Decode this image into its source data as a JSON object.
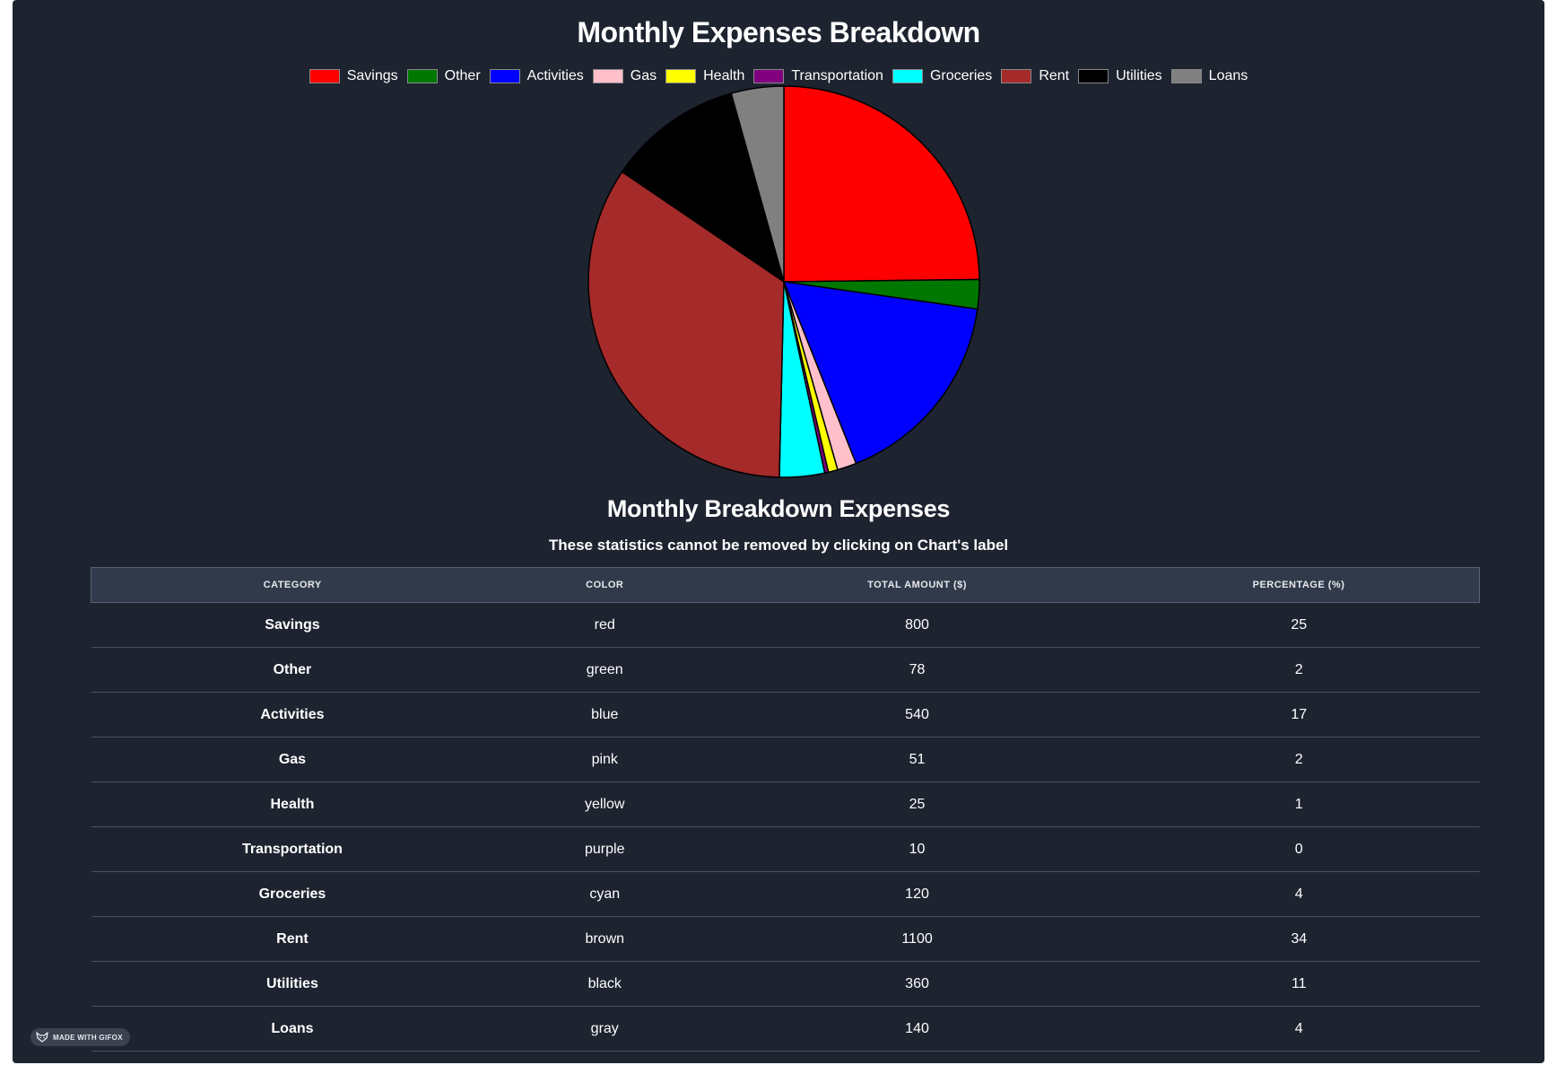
{
  "chart_data": {
    "type": "pie",
    "title": "Monthly Expenses Breakdown",
    "categories": [
      "Savings",
      "Other",
      "Activities",
      "Gas",
      "Health",
      "Transportation",
      "Groceries",
      "Rent",
      "Utilities",
      "Loans"
    ],
    "values": [
      800,
      78,
      540,
      51,
      25,
      10,
      120,
      1100,
      360,
      140
    ],
    "colors": [
      "#ff0000",
      "#007800",
      "#0000ff",
      "#ffc0cb",
      "#ffff00",
      "#800080",
      "#00ffff",
      "#a52a2a",
      "#000000",
      "#808080"
    ],
    "legend_position": "top"
  },
  "table": {
    "title": "Monthly Breakdown Expenses",
    "subtitle": "These statistics cannot be removed by clicking on Chart's label",
    "headers": [
      "CATEGORY",
      "COLOR",
      "TOTAL AMOUNT ($)",
      "PERCENTAGE (%)"
    ],
    "rows": [
      {
        "category": "Savings",
        "color": "red",
        "amount": "800",
        "percentage": "25"
      },
      {
        "category": "Other",
        "color": "green",
        "amount": "78",
        "percentage": "2"
      },
      {
        "category": "Activities",
        "color": "blue",
        "amount": "540",
        "percentage": "17"
      },
      {
        "category": "Gas",
        "color": "pink",
        "amount": "51",
        "percentage": "2"
      },
      {
        "category": "Health",
        "color": "yellow",
        "amount": "25",
        "percentage": "1"
      },
      {
        "category": "Transportation",
        "color": "purple",
        "amount": "10",
        "percentage": "0"
      },
      {
        "category": "Groceries",
        "color": "cyan",
        "amount": "120",
        "percentage": "4"
      },
      {
        "category": "Rent",
        "color": "brown",
        "amount": "1100",
        "percentage": "34"
      },
      {
        "category": "Utilities",
        "color": "black",
        "amount": "360",
        "percentage": "11"
      },
      {
        "category": "Loans",
        "color": "gray",
        "amount": "140",
        "percentage": "4"
      }
    ]
  },
  "badge": {
    "text": "MADE WITH GIFOX",
    "icon": "fox-icon"
  }
}
